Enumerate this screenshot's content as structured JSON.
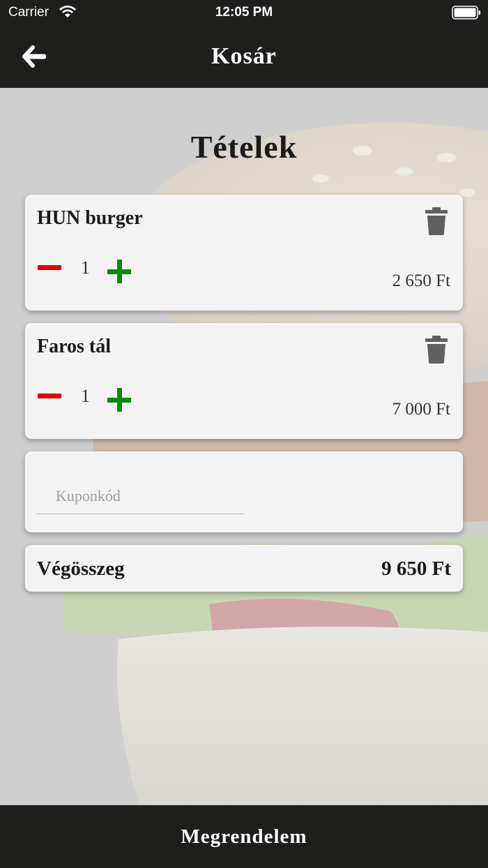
{
  "status_bar": {
    "carrier": "Carrier",
    "time": "12:05 PM"
  },
  "nav": {
    "title": "Kosár",
    "back_icon": "arrow-left-icon"
  },
  "cart": {
    "section_title": "Tételek",
    "items": [
      {
        "name": "HUN burger",
        "quantity": "1",
        "price": "2 650 Ft"
      },
      {
        "name": "Faros tál",
        "quantity": "1",
        "price": "7 000 Ft"
      }
    ],
    "coupon": {
      "placeholder": "Kuponkód",
      "value": ""
    },
    "total_label": "Végösszeg",
    "total_value": "9 650 Ft"
  },
  "order_button": {
    "label": "Megrendelem"
  },
  "colors": {
    "bar": "#1e1f1c",
    "minus": "#e00000",
    "plus": "#0a8a0a",
    "card": "#f3f3f3"
  }
}
